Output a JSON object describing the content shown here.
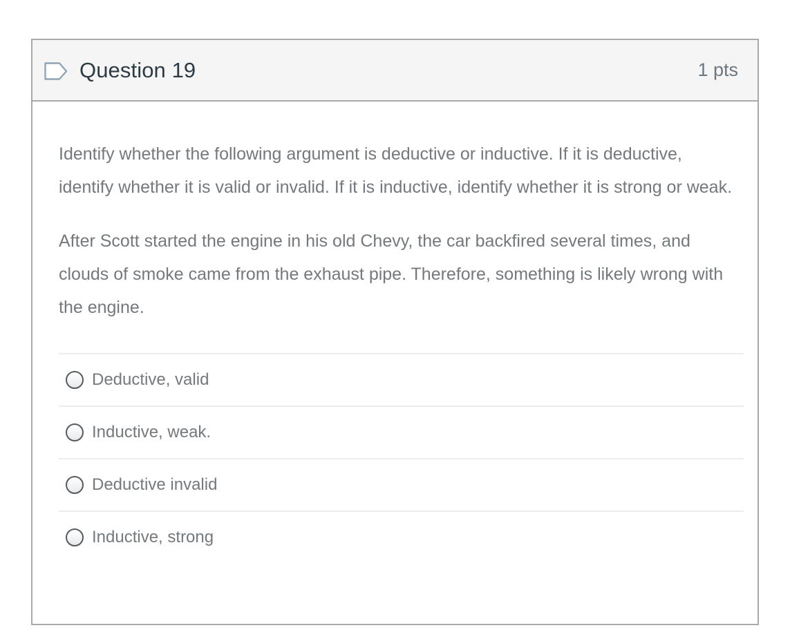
{
  "question": {
    "icon": "flag-outline-icon",
    "name": "Question 19",
    "points": "1 pts",
    "paragraphs": [
      "Identify whether the following argument is deductive or inductive. If it is deductive, identify whether it is valid or invalid. If it is inductive, identify whether it is strong or weak.",
      "After Scott started the engine in his old Chevy, the car backfired several times, and clouds of smoke came from the exhaust pipe. Therefore, something is likely wrong with the engine."
    ],
    "answers": [
      {
        "label": "Deductive, valid",
        "selected": false
      },
      {
        "label": "Inductive, weak.",
        "selected": false
      },
      {
        "label": "Deductive invalid",
        "selected": false
      },
      {
        "label": "Inductive, strong",
        "selected": false
      }
    ]
  },
  "colors": {
    "header_background": "#f5f5f5",
    "card_border": "#a9a9a9",
    "title_text": "#2d3b45",
    "body_text": "#74797d",
    "icon_stroke": "#8fa5b5",
    "divider": "#ededed"
  }
}
